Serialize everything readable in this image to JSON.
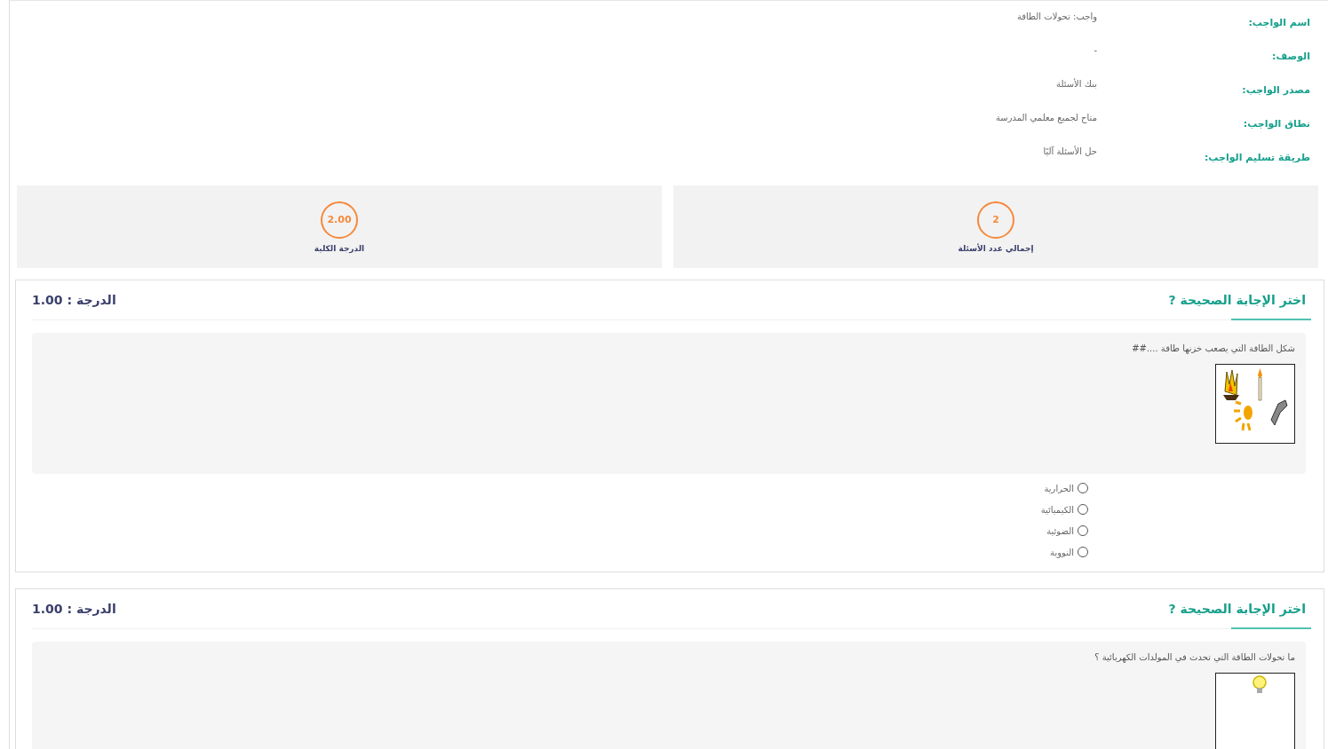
{
  "info": [
    {
      "label": "اسم الواجب:",
      "value": "واجب: تحولات الطاقة"
    },
    {
      "label": "الوصف:",
      "value": "-"
    },
    {
      "label": "مصدر الواجب:",
      "value": "بنك الأسئلة"
    },
    {
      "label": "نطاق الواجب:",
      "value": "متاح لجميع معلمي المدرسة"
    },
    {
      "label": "طريقة تسليم الواجب:",
      "value": "حل الأسئلة آليًا"
    }
  ],
  "stats": [
    {
      "value": "2",
      "label": "إجمالي عدد الأسئلة"
    },
    {
      "value": "2.00",
      "label": "الدرجة الكلية"
    }
  ],
  "questions": [
    {
      "title": "اختر الإجابة الصحيحة ?",
      "grade": "الدرجة : 1.00",
      "text": "شكل الطاقة التي يصعب خزنها طاقة ....##",
      "kind": "energy",
      "options": [
        {
          "label": "الحرارية",
          "selected": false
        },
        {
          "label": "الكيميائية",
          "selected": false
        },
        {
          "label": "الضوئية",
          "selected": false
        },
        {
          "label": "النووية",
          "selected": false
        }
      ]
    },
    {
      "title": "اختر الإجابة الصحيحة ?",
      "grade": "الدرجة : 1.00",
      "text": "ما تحولات الطاقة التي تحدث في المولدات الكهربائية ؟",
      "kind": "bulb"
    }
  ]
}
